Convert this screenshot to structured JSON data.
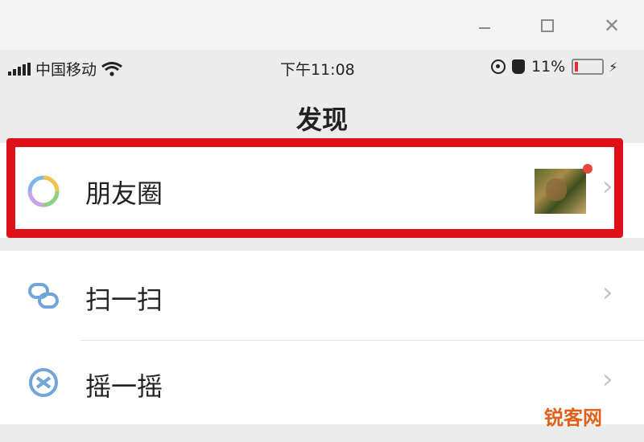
{
  "status_bar": {
    "carrier": "中国移动",
    "time": "下午11:08",
    "battery_percent": "11%",
    "battery_level": 0.11
  },
  "nav": {
    "title": "发现"
  },
  "rows": [
    {
      "label": "朋友圈",
      "icon": "moments-icon"
    },
    {
      "label": "扫一扫",
      "icon": "scan-icon"
    },
    {
      "label": "摇一摇",
      "icon": "shake-icon"
    }
  ],
  "colors": {
    "highlight": "#e01018",
    "badge": "#e8453c",
    "watermark": "#e0601a"
  },
  "watermark": "锐客网"
}
